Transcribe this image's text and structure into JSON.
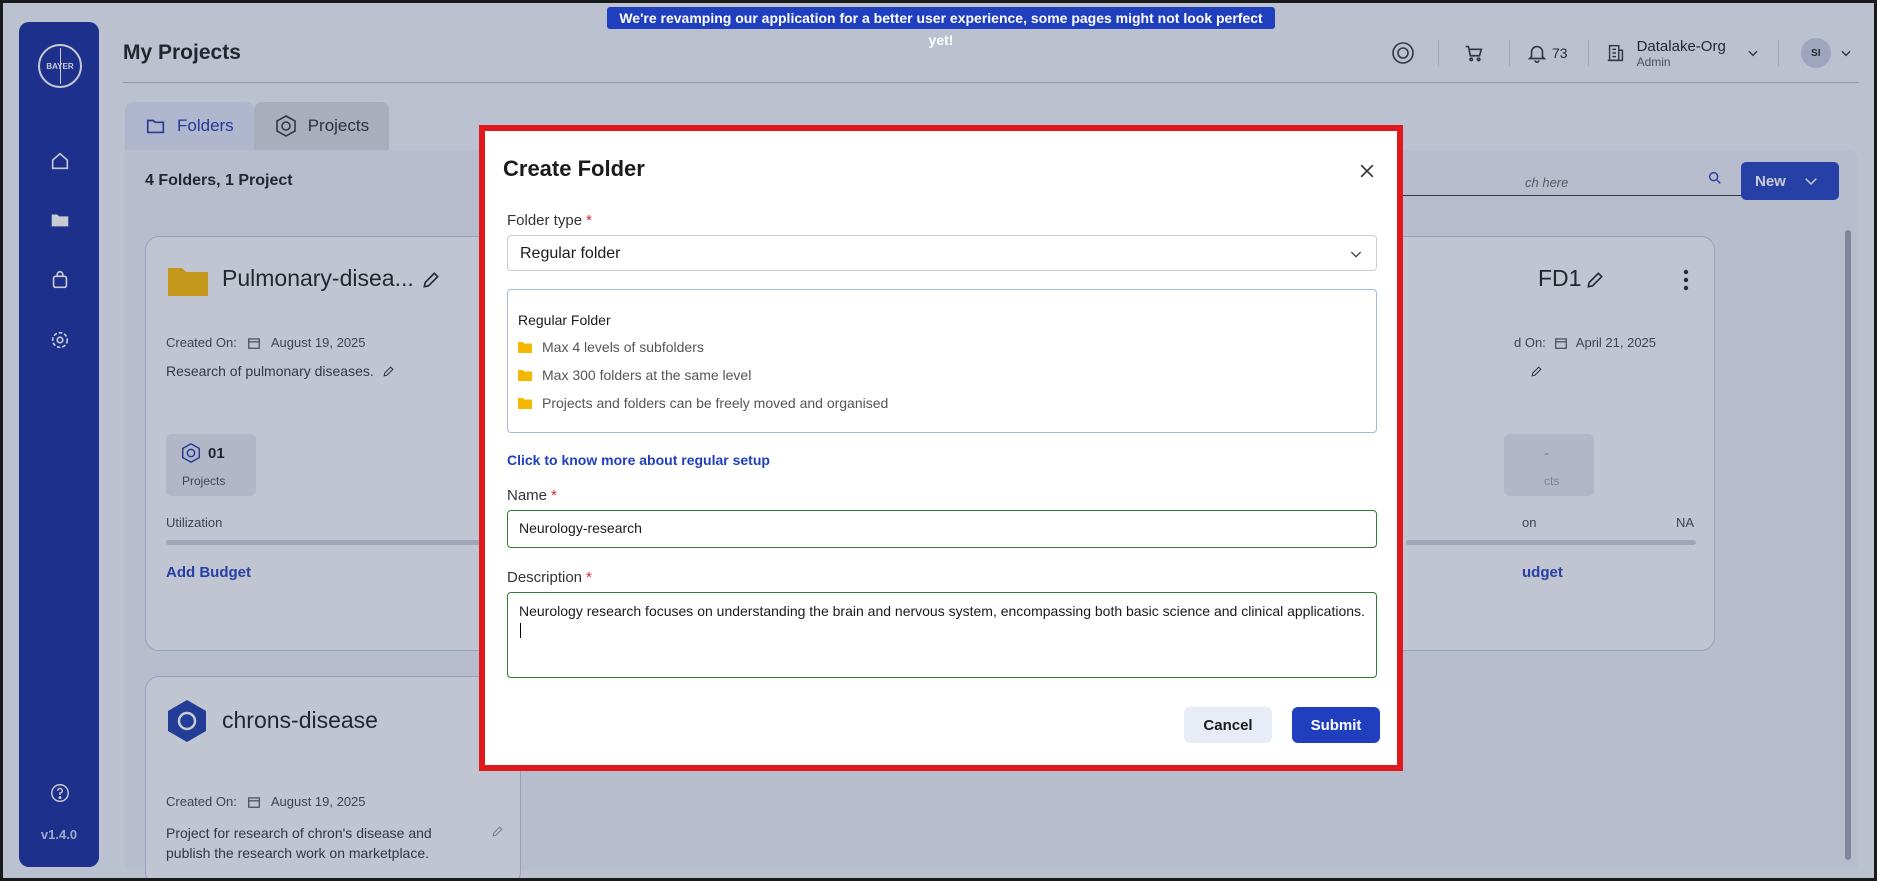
{
  "banner": "We're revamping our application for a better user experience, some pages might not look perfect yet!",
  "sidebar": {
    "logo_text": "BAYER",
    "version": "v1.4.0"
  },
  "header": {
    "title": "My Projects",
    "notifications_count": "73",
    "org_name": "Datalake-Org",
    "org_role": "Admin",
    "avatar_initials": "SI"
  },
  "tabs": [
    {
      "label": "Folders"
    },
    {
      "label": "Projects"
    }
  ],
  "toolbar": {
    "count_label": "4 Folders, 1 Project",
    "search_placeholder": "ch here",
    "new_label": "New"
  },
  "cards": [
    {
      "title": "Pulmonary-disea...",
      "created_label": "Created On:",
      "created_date": "August 19, 2025",
      "description": "Research of pulmonary diseases.",
      "projects_count": "01",
      "projects_label": "Projects",
      "utilization_label": "Utilization",
      "budget_label": "Add Budget"
    },
    {
      "title": "FD1",
      "created_label": "d On:",
      "created_date": "April 21, 2025",
      "projects_count": "-",
      "projects_label": "cts",
      "utilization_label": "on",
      "utilization_value": "NA",
      "budget_label": "udget"
    },
    {
      "title": "chrons-disease",
      "created_label": "Created On:",
      "created_date": "August 19, 2025",
      "description": "Project for research of chron's disease and publish the research work on marketplace."
    }
  ],
  "modal": {
    "title": "Create Folder",
    "folder_type_label": "Folder type",
    "folder_type_value": "Regular folder",
    "info_title": "Regular Folder",
    "info_items": [
      "Max 4 levels of subfolders",
      "Max 300 folders at the same level",
      "Projects and folders can be freely moved and organised"
    ],
    "learn_more": "Click to know more about regular setup",
    "name_label": "Name",
    "name_value": "Neurology-research",
    "description_label": "Description",
    "description_value": "Neurology research focuses on understanding the brain and nervous system, encompassing both basic science and clinical applications.",
    "required_mark": "*",
    "cancel_label": "Cancel",
    "submit_label": "Submit"
  },
  "colors": {
    "brand": "#10299c",
    "primary_button": "#1f3fbf",
    "highlight_border": "#e0191c",
    "valid_border": "#2e7d32",
    "folder_icon": "#f5b800"
  }
}
